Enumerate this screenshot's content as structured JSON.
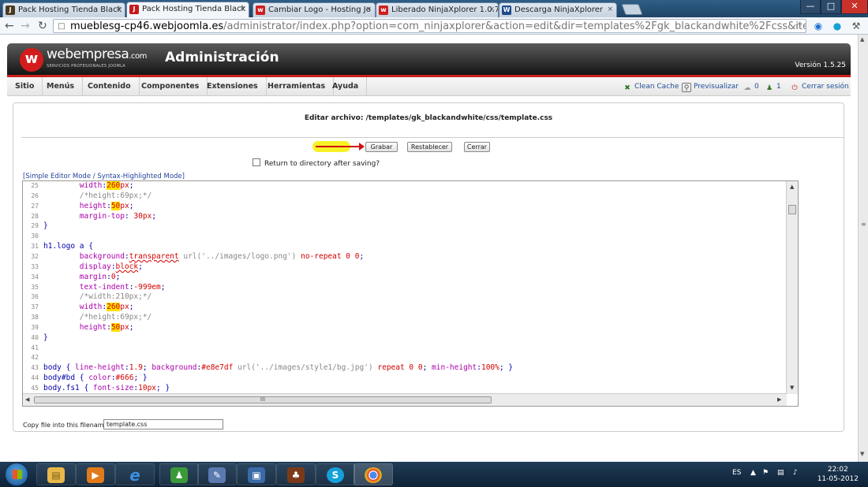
{
  "browser": {
    "tabs": [
      {
        "label": "Pack Hosting Tienda Black",
        "color": "#4a3a20",
        "glyph": "J",
        "active": false
      },
      {
        "label": "Pack Hosting Tienda Black",
        "color": "#c41a1a",
        "glyph": "J",
        "active": true
      },
      {
        "label": "Cambiar Logo - Hosting Jo",
        "color": "#cc1f1f",
        "glyph": "w",
        "active": false
      },
      {
        "label": "Liberado NinjaXplorer 1.0.7",
        "color": "#cc1f1f",
        "glyph": "w",
        "active": false
      },
      {
        "label": "Descarga NinjaXplorer",
        "color": "#1e4a8a",
        "glyph": "W",
        "active": false
      }
    ],
    "url": {
      "domain": "mueblesg-cp46.webjoomla.es",
      "path": "/administrator/index.php?option=com_ninjaxplorer&action=edit&dir=templates%2Fgk_blackandwhite%2Fcss&item=template.css&order=na"
    }
  },
  "admin": {
    "logo_text": "webempresa",
    "logo_suffix": ".com",
    "logo_sub": "SERVICIOS PROFESIONALES JOOMLA",
    "title": "Administración",
    "version": "Versión 1.5.25",
    "menu": [
      "Sitio",
      "Menús",
      "Contenido",
      "Componentes",
      "Extensiones",
      "Herramientas",
      "Ayuda"
    ],
    "right_menu": {
      "clean_cache": "Clean Cache",
      "preview": "Previsualizar",
      "messages_count": "0",
      "users_count": "1",
      "logout": "Cerrar sesión"
    }
  },
  "editor": {
    "title": "Editar archivo: /templates/gk_blackandwhite/css/template.css",
    "buttons": {
      "save": "Grabar",
      "reset": "Restablecer",
      "close": "Cerrar"
    },
    "return_label": "Return to directory after saving?",
    "mode_link": "[Simple Editor Mode / Syntax-Highlighted Mode]",
    "copy_label": "Copy file into this filename",
    "copy_value": "template.css",
    "hscroll_mark": "III",
    "lines": [
      {
        "n": "25",
        "html": "        <span class=\"prop\">width</span>:<span class=\"hlv val\">260</span><span class=\"val\">px</span>;"
      },
      {
        "n": "26",
        "html": "        <span class=\"cmt\">/*height:69px;*/</span>"
      },
      {
        "n": "27",
        "html": "        <span class=\"prop\">height</span>:<span class=\"hlv val\">50</span><span class=\"val\">px</span>;"
      },
      {
        "n": "28",
        "html": "        <span class=\"prop\">margin-top</span>: <span class=\"val\">30px</span>;"
      },
      {
        "n": "29",
        "html": "}"
      },
      {
        "n": "30",
        "html": ""
      },
      {
        "n": "31",
        "html": "h1.logo a {"
      },
      {
        "n": "32",
        "html": "        <span class=\"prop\">background</span>:<span class=\"val\" style=\"text-decoration:underline wavy #d40000\">transparent</span> <span class=\"cmt\">url('../images/logo.png')</span> <span class=\"val\">no-repeat 0 0</span>;"
      },
      {
        "n": "33",
        "html": "        <span class=\"prop\">display</span>:<span class=\"val\" style=\"text-decoration:underline wavy #d40000\">block</span>;"
      },
      {
        "n": "34",
        "html": "        <span class=\"prop\">margin</span>:<span class=\"val\">0</span>;"
      },
      {
        "n": "35",
        "html": "        <span class=\"prop\">text-indent</span>:<span class=\"val\">-999em</span>;"
      },
      {
        "n": "36",
        "html": "        <span class=\"cmt\">/*width:210px;*/</span>"
      },
      {
        "n": "37",
        "html": "        <span class=\"prop\">width</span>:<span class=\"hlv val\">260</span><span class=\"val\">px</span>;"
      },
      {
        "n": "38",
        "html": "        <span class=\"cmt\">/*height:69px;*/</span>"
      },
      {
        "n": "39",
        "html": "        <span class=\"prop\">height</span>:<span class=\"hlv val\">50</span><span class=\"val\">px</span>;"
      },
      {
        "n": "40",
        "html": "}"
      },
      {
        "n": "41",
        "html": ""
      },
      {
        "n": "42",
        "html": ""
      },
      {
        "n": "43",
        "html": "body { <span class=\"prop\">line-height</span>:<span class=\"val\">1.9</span>; <span class=\"prop\">background</span>:<span class=\"val\">#e8e7df</span> <span class=\"cmt\">url('../images/style1/bg.jpg')</span> <span class=\"val\">repeat 0 0</span>; <span class=\"prop\">min-height</span>:<span class=\"val\">100%</span>; }"
      },
      {
        "n": "44",
        "html": "body#bd { <span class=\"prop\">color</span>:<span class=\"val\">#666</span>; }"
      },
      {
        "n": "45",
        "html": "body.fs1 { <span class=\"prop\">font-size</span>:<span class=\"val\">10px</span>; }"
      }
    ]
  },
  "taskbar": {
    "lang": "ES",
    "time": "22:02",
    "date": "11-05-2012"
  }
}
